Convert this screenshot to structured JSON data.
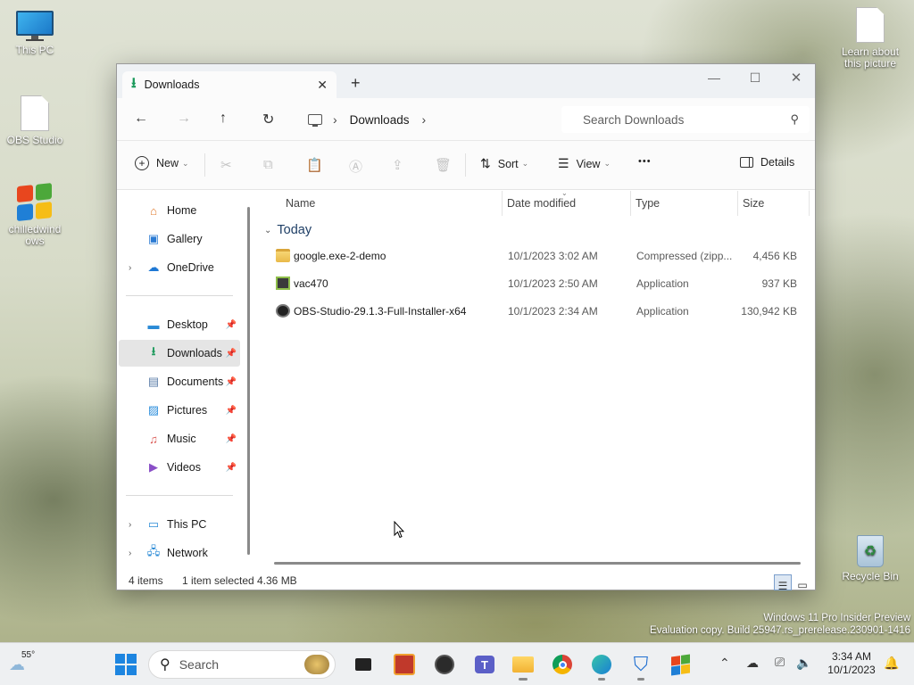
{
  "desktop": {
    "icons": [
      {
        "label": "This PC"
      },
      {
        "label": "OBS Studio"
      },
      {
        "label": "chilledwindows"
      },
      {
        "label": "Learn about this picture"
      },
      {
        "label": "Recycle Bin"
      }
    ],
    "watermark_line1": "Windows 11 Pro Insider Preview",
    "watermark_line2": "Evaluation copy. Build 25947.rs_prerelease.230901-1416"
  },
  "window": {
    "tab_title": "Downloads",
    "tab_close": "✕",
    "new_tab": "+",
    "controls": {
      "minimize": "—",
      "maximize": "☐",
      "close": "✕"
    }
  },
  "address": {
    "back": "←",
    "forward": "→",
    "up": "↑",
    "refresh": "↻",
    "breadcrumb": [
      "Downloads"
    ],
    "search_placeholder": "Search Downloads"
  },
  "toolbar": {
    "new_label": "New",
    "sort_label": "Sort",
    "view_label": "View",
    "more_label": "•••",
    "details_label": "Details"
  },
  "sidebar": {
    "top": [
      {
        "label": "Home",
        "icon": "home-icon"
      },
      {
        "label": "Gallery",
        "icon": "gallery-icon"
      },
      {
        "label": "OneDrive",
        "icon": "cloud-icon"
      }
    ],
    "quick": [
      {
        "label": "Desktop",
        "icon": "desktop-icon"
      },
      {
        "label": "Downloads",
        "icon": "download-icon",
        "selected": true
      },
      {
        "label": "Documents",
        "icon": "documents-icon"
      },
      {
        "label": "Pictures",
        "icon": "pictures-icon"
      },
      {
        "label": "Music",
        "icon": "music-icon"
      },
      {
        "label": "Videos",
        "icon": "videos-icon"
      }
    ],
    "bottom": [
      {
        "label": "This PC",
        "icon": "computer-icon"
      },
      {
        "label": "Network",
        "icon": "network-icon"
      }
    ]
  },
  "files": {
    "columns": [
      "Name",
      "Date modified",
      "Type",
      "Size"
    ],
    "group_label": "Today",
    "rows": [
      {
        "name": "google.exe-2-demo",
        "date": "10/1/2023 3:02 AM",
        "type": "Compressed (zipp...",
        "size": "4,456 KB",
        "icon": "zip-folder-icon"
      },
      {
        "name": "vac470",
        "date": "10/1/2023 2:50 AM",
        "type": "Application",
        "size": "937 KB",
        "icon": "application-icon"
      },
      {
        "name": "OBS-Studio-29.1.3-Full-Installer-x64",
        "date": "10/1/2023 2:34 AM",
        "type": "Application",
        "size": "130,942 KB",
        "icon": "obs-installer-icon"
      }
    ]
  },
  "status": {
    "count": "4 items",
    "selection": "1 item selected",
    "selection_size": "4.36 MB"
  },
  "taskbar": {
    "weather_temp": "55°",
    "search_label": "Search",
    "time": "3:34 AM",
    "date": "10/1/2023"
  }
}
